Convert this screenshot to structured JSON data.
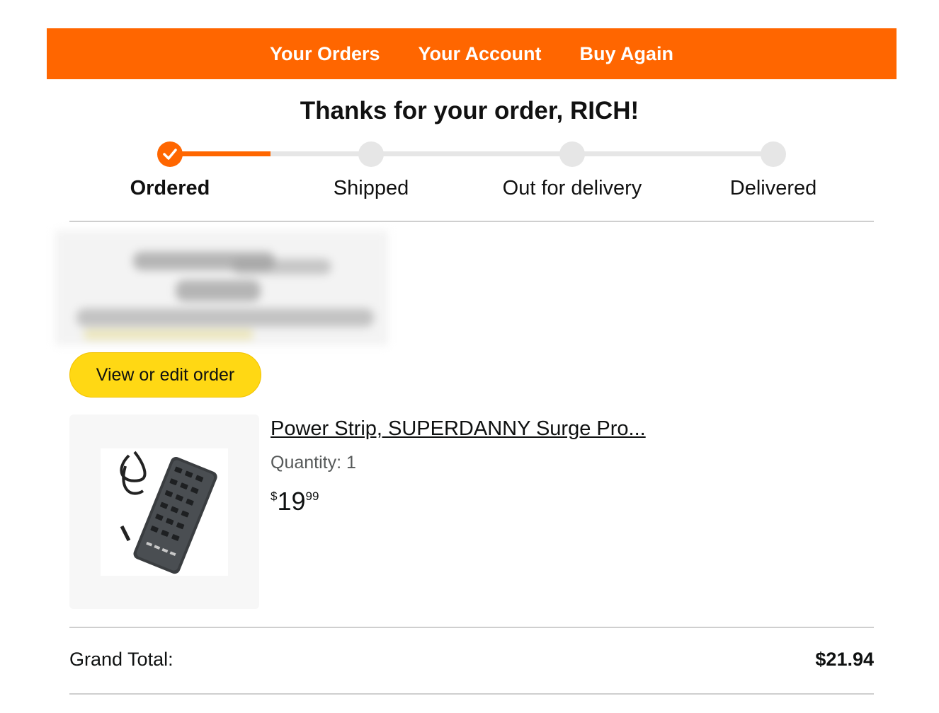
{
  "nav": {
    "items": [
      "Your Orders",
      "Your Account",
      "Buy Again"
    ]
  },
  "header": {
    "title": "Thanks for your order, RICH!"
  },
  "tracker": {
    "steps": [
      "Ordered",
      "Shipped",
      "Out for delivery",
      "Delivered"
    ],
    "current_step": "Ordered",
    "progress_fraction": 0.17
  },
  "actions": {
    "view_edit_label": "View or edit order"
  },
  "item": {
    "title": "Power Strip, SUPERDANNY Surge Pro...",
    "quantity": "Quantity: 1",
    "price_symbol": "$",
    "price_whole": "19",
    "price_fraction": "99",
    "image_icon": "power-strip-icon"
  },
  "summary": {
    "grand_total_label": "Grand Total:",
    "grand_total_value": "$21.94"
  },
  "colors": {
    "accent": "#ff6600",
    "button": "#ffd814",
    "track_inactive": "#e6e6e6"
  }
}
